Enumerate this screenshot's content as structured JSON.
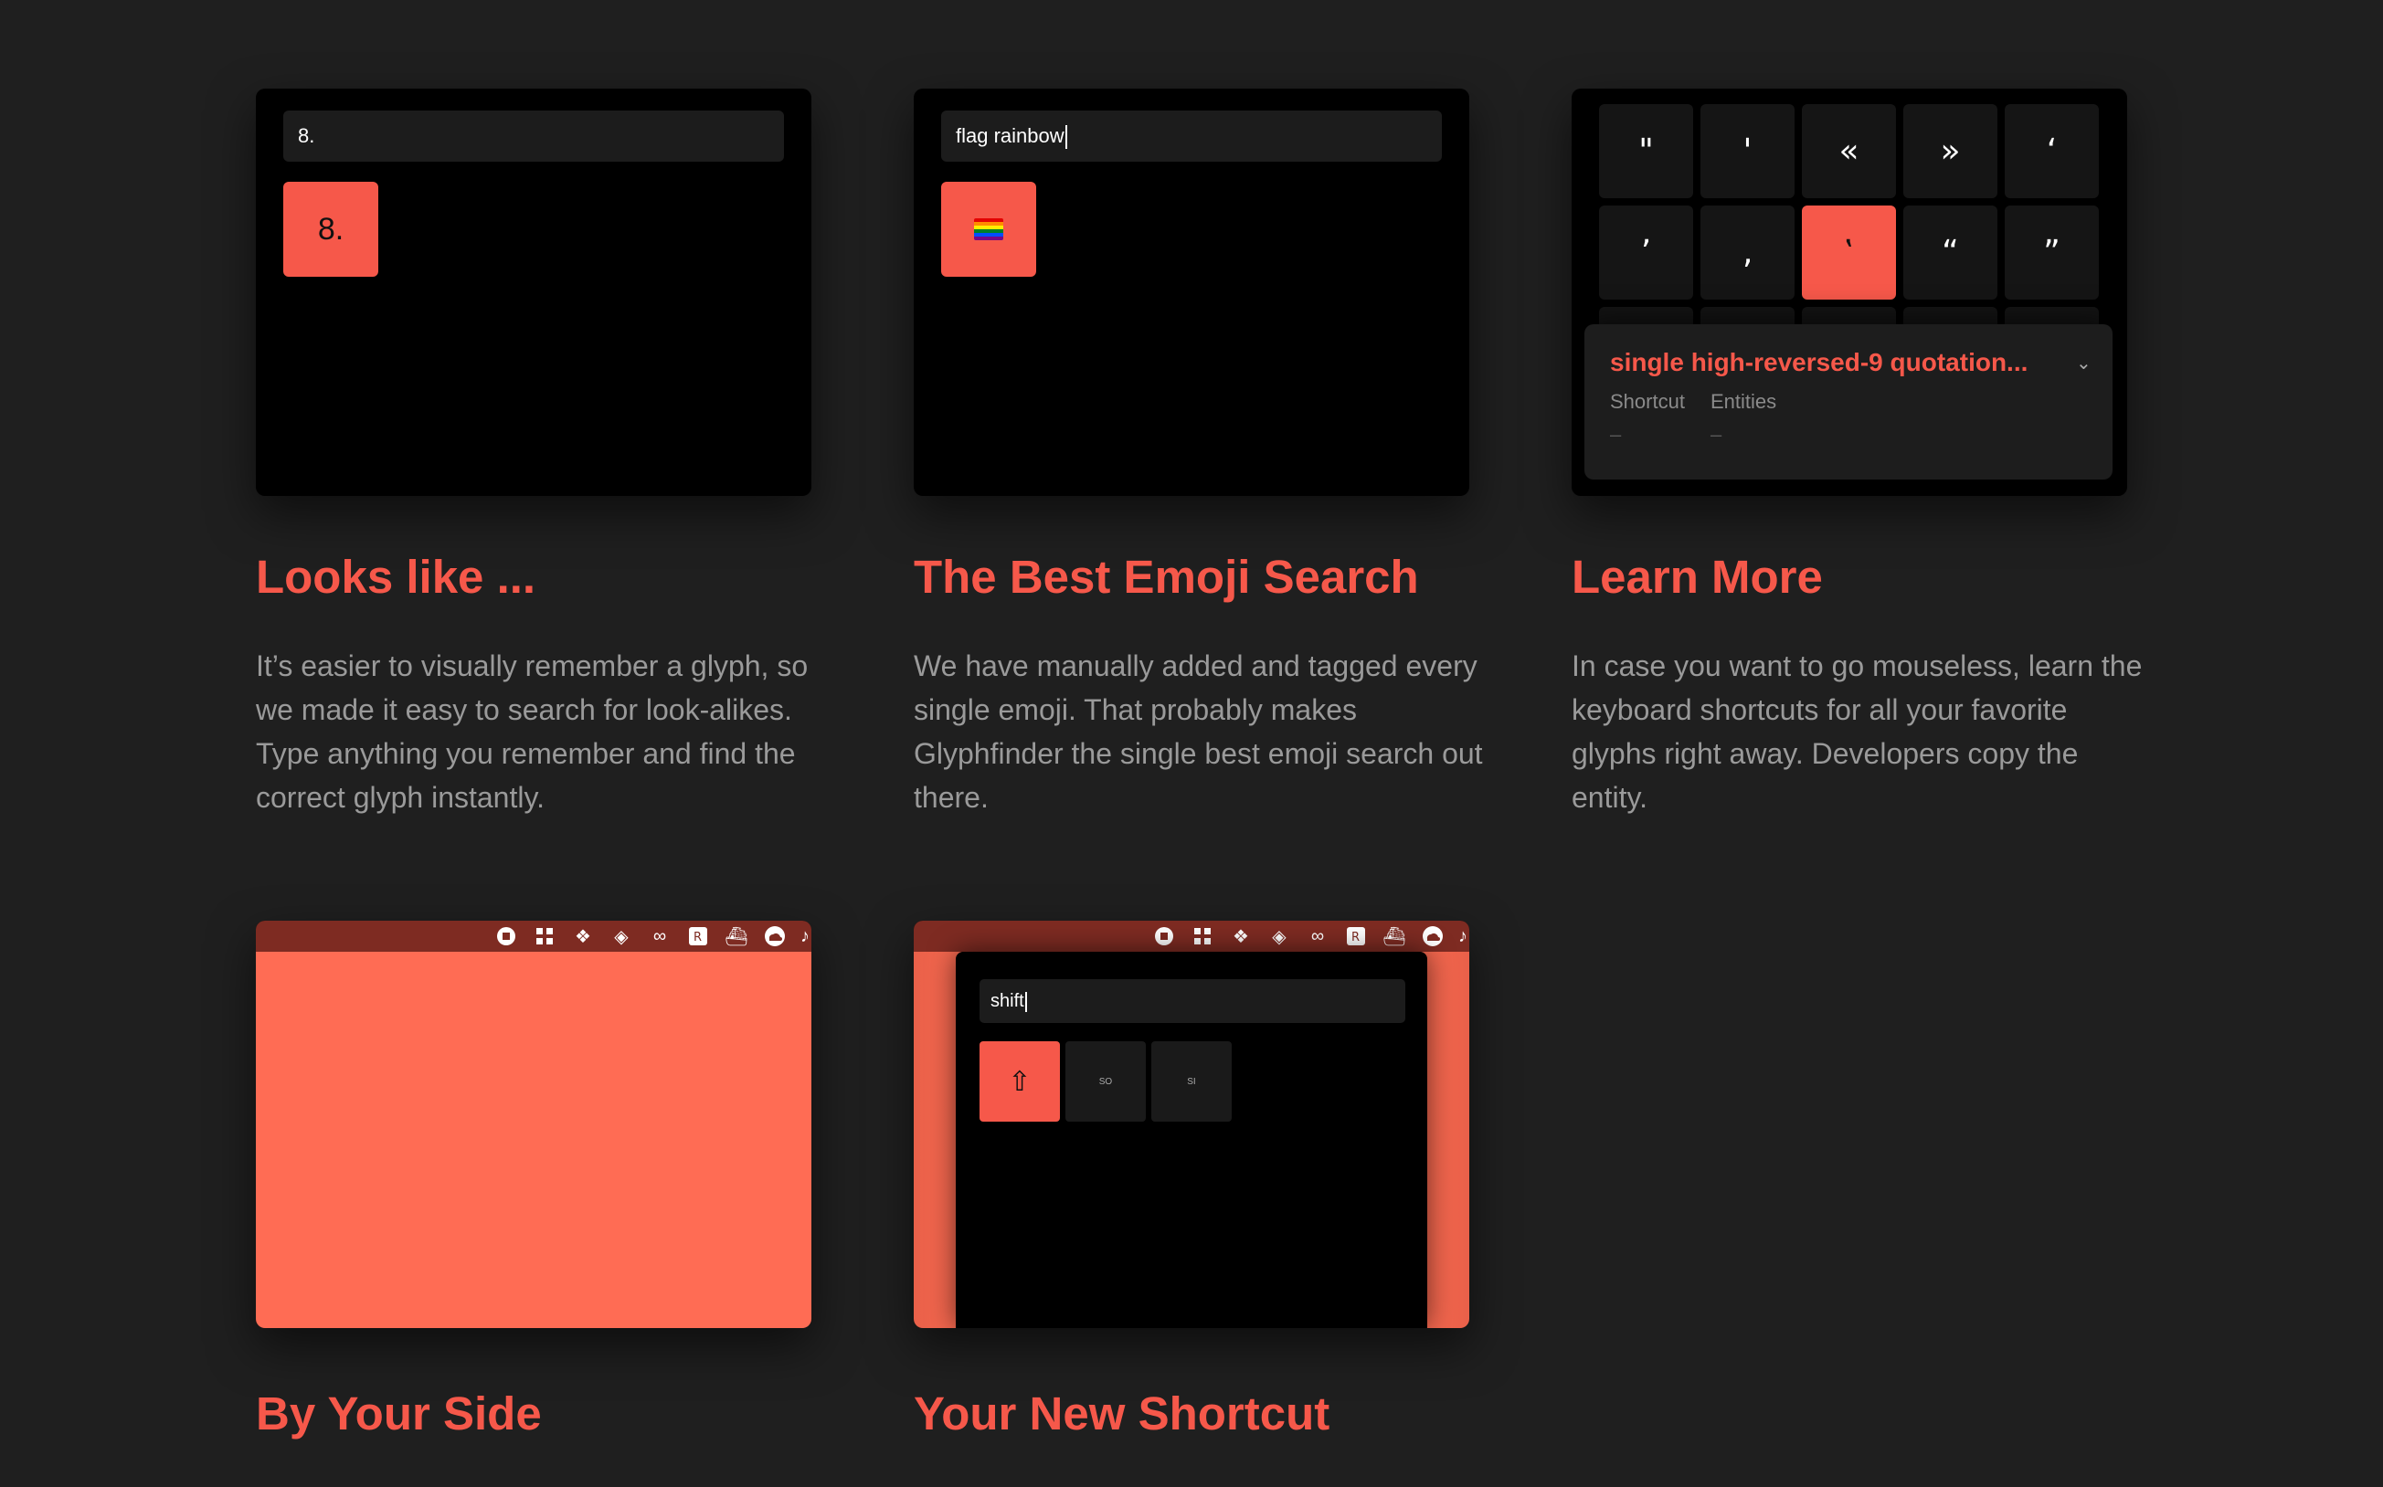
{
  "cards": [
    {
      "title": "Looks like ...",
      "description": "It’s easier to visually remember a glyph, so we made it easy to search for look-alikes. Type anything you remember and find the correct glyph instantly.",
      "search_value": "8.",
      "result": "8."
    },
    {
      "title": "The Best Emoji Search",
      "description": "We have manually added and tagged every single emoji. That probably makes Glyphfinder the single best emoji search out there.",
      "search_value": "flag rainbow",
      "result_icon": "rainbow-flag-emoji"
    },
    {
      "title": "Learn More",
      "description": "In case you want to go mouseless, learn the keyboard shortcuts for all your favorite glyphs right away. Developers copy the entity.",
      "glyphs": [
        "\"",
        "'",
        "«",
        "»",
        "‘",
        "’",
        "‚",
        "‛",
        "“",
        "”"
      ],
      "selected_glyph_index": 7,
      "info_title": "single high-reversed-9 quotation...",
      "info_labels": [
        "Shortcut",
        "Entities"
      ],
      "info_values": [
        "–",
        "–"
      ]
    },
    {
      "title": "By Your Side",
      "menubar_icons": [
        "record-icon",
        "grid-icon",
        "dropbox-icon",
        "dropbox-alt-icon",
        "creative-cloud-icon",
        "r-app-icon",
        "docker-icon",
        "cloud-icon",
        "music-icon"
      ]
    },
    {
      "title": "Your New Shortcut",
      "search_value": "shift",
      "results": [
        "⇧",
        "SO",
        "SI"
      ]
    }
  ],
  "colors": {
    "background": "#1f1f1f",
    "accent": "#f6584a",
    "panel": "#000000"
  }
}
